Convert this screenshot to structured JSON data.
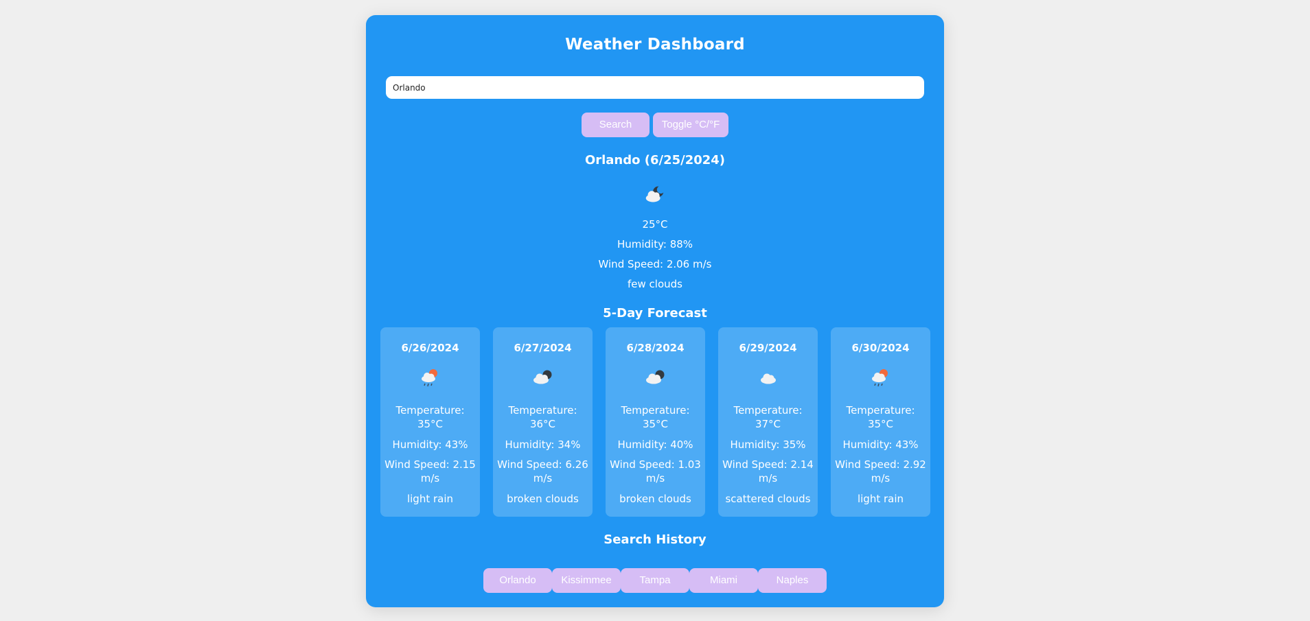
{
  "app": {
    "title": "Weather Dashboard"
  },
  "search": {
    "value": "Orlando",
    "search_label": "Search",
    "toggle_label": "Toggle °C/°F"
  },
  "current": {
    "heading": "Orlando (6/25/2024)",
    "icon": "few-clouds-night-icon",
    "temperature": "25°C",
    "humidity": "Humidity: 88%",
    "wind": "Wind Speed: 2.06 m/s",
    "description": "few clouds"
  },
  "forecast": {
    "title": "5-Day Forecast",
    "days": [
      {
        "date": "6/26/2024",
        "icon": "light-rain-icon",
        "temperature": "Temperature: 35°C",
        "humidity": "Humidity: 43%",
        "wind": "Wind Speed: 2.15 m/s",
        "description": "light rain"
      },
      {
        "date": "6/27/2024",
        "icon": "broken-clouds-icon",
        "temperature": "Temperature: 36°C",
        "humidity": "Humidity: 34%",
        "wind": "Wind Speed: 6.26 m/s",
        "description": "broken clouds"
      },
      {
        "date": "6/28/2024",
        "icon": "broken-clouds-icon",
        "temperature": "Temperature: 35°C",
        "humidity": "Humidity: 40%",
        "wind": "Wind Speed: 1.03 m/s",
        "description": "broken clouds"
      },
      {
        "date": "6/29/2024",
        "icon": "scattered-clouds-icon",
        "temperature": "Temperature: 37°C",
        "humidity": "Humidity: 35%",
        "wind": "Wind Speed: 2.14 m/s",
        "description": "scattered clouds"
      },
      {
        "date": "6/30/2024",
        "icon": "light-rain-icon",
        "temperature": "Temperature: 35°C",
        "humidity": "Humidity: 43%",
        "wind": "Wind Speed: 2.92 m/s",
        "description": "light rain"
      }
    ]
  },
  "history": {
    "title": "Search History",
    "items": [
      "Orlando",
      "Kissimmee",
      "Tampa",
      "Miami",
      "Naples"
    ]
  },
  "colors": {
    "page_background": "#efefef",
    "panel": "#2196f3",
    "card": "#4dabf5",
    "button": "#d6bdf5",
    "text": "#ffffff"
  }
}
